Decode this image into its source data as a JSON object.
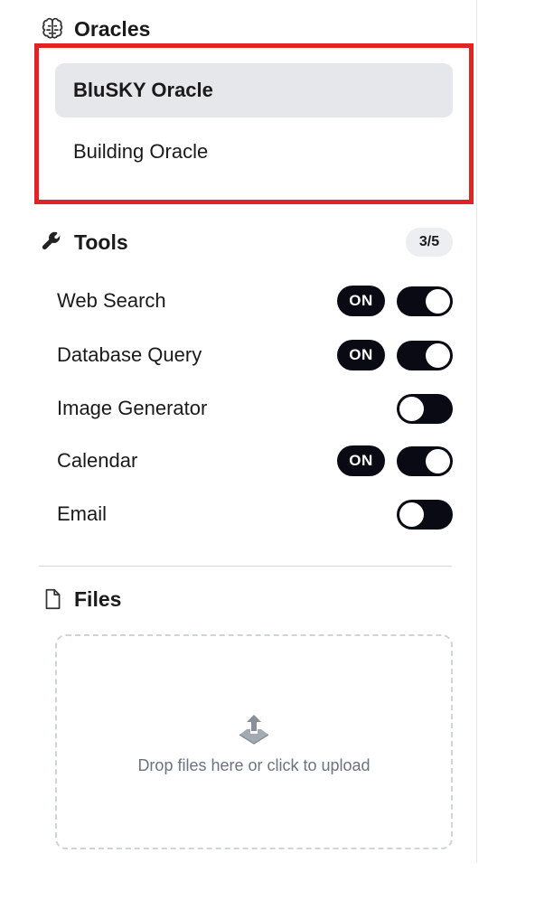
{
  "oracles": {
    "title": "Oracles",
    "icon": "brain-icon",
    "items": [
      {
        "label": "BluSKY Oracle",
        "active": true
      },
      {
        "label": "Building Oracle",
        "active": false
      }
    ]
  },
  "tools": {
    "title": "Tools",
    "icon": "wrench-icon",
    "count": "3/5",
    "on_label": "ON",
    "items": [
      {
        "label": "Web Search",
        "enabled": true
      },
      {
        "label": "Database Query",
        "enabled": true
      },
      {
        "label": "Image Generator",
        "enabled": false
      },
      {
        "label": "Calendar",
        "enabled": true
      },
      {
        "label": "Email",
        "enabled": false
      }
    ]
  },
  "files": {
    "title": "Files",
    "icon": "file-icon",
    "dropzone_text": "Drop files here or click to upload",
    "dropzone_icon": "upload-icon"
  },
  "colors": {
    "highlight": "#e02424",
    "toggle_on": "#0a0a14",
    "active_item_bg": "#e5e7eb"
  }
}
